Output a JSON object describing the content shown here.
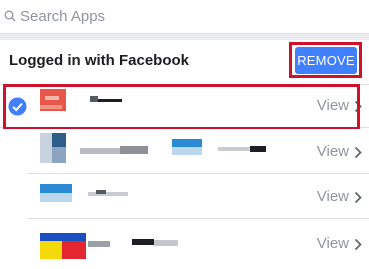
{
  "search": {
    "placeholder": "Search Apps"
  },
  "section": {
    "title": "Logged in with Facebook",
    "remove_label": "REMOVE"
  },
  "apps": [
    {
      "view_label": "View",
      "selected": true
    },
    {
      "view_label": "View",
      "selected": false
    },
    {
      "view_label": "View",
      "selected": false
    },
    {
      "view_label": "View",
      "selected": false
    }
  ],
  "colors": {
    "accent": "#4080ff",
    "highlight": "#d0112b",
    "muted_text": "#90949c",
    "divider": "#dddfe2"
  },
  "icons": [
    "search-icon",
    "check-circle-icon",
    "chevron-right-icon"
  ]
}
